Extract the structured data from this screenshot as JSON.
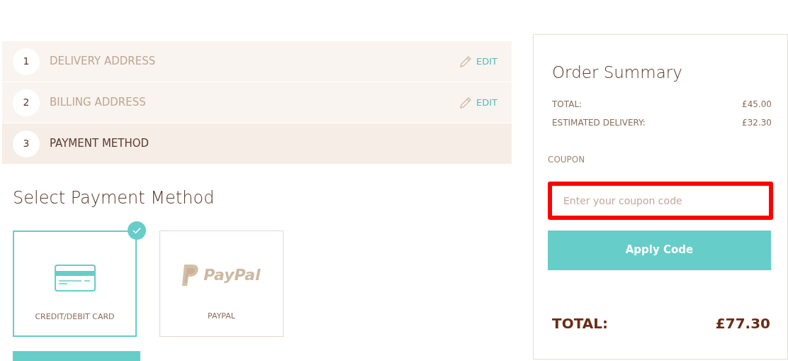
{
  "steps": [
    {
      "number": "1",
      "label": "DELIVERY ADDRESS",
      "selected": false,
      "edit": "EDIT"
    },
    {
      "number": "2",
      "label": "BILLING ADDRESS",
      "selected": false,
      "edit": "EDIT"
    },
    {
      "number": "3",
      "label": "PAYMENT METHOD",
      "selected": true
    }
  ],
  "payment": {
    "title": "Select Payment Method",
    "options": [
      {
        "kind": "card",
        "label": "CREDIT/DEBIT CARD",
        "selected": true
      },
      {
        "kind": "paypal",
        "logo_text": "PayPal",
        "label": "PAYPAL",
        "selected": false
      }
    ]
  },
  "summary": {
    "title": "Order Summary",
    "lines": [
      {
        "label": "TOTAL:",
        "value": "£45.00"
      },
      {
        "label": "ESTIMATED DELIVERY:",
        "value": "£32.30"
      }
    ],
    "coupon": {
      "label": "COUPON",
      "placeholder": "Enter your coupon code",
      "highlighted": true
    },
    "apply_button": "Apply Code",
    "total": {
      "label": "TOTAL:",
      "value": "£77.30"
    }
  }
}
